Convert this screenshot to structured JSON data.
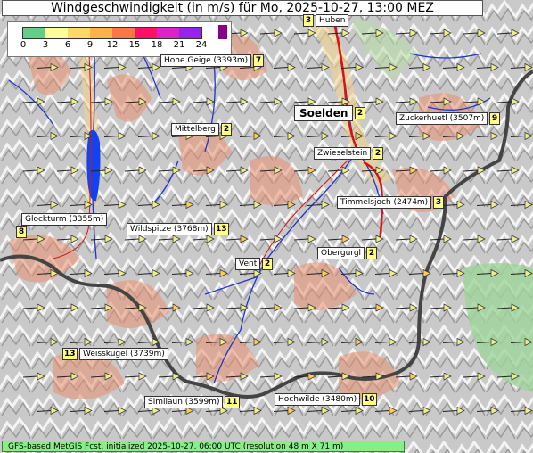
{
  "title": "Windgeschwindigkeit (in m/s) für Mo, 2025-10-27, 13:00 MEZ",
  "legend": {
    "ticks": [
      "0",
      "3",
      "6",
      "9",
      "12",
      "15",
      "18",
      "21",
      "24"
    ],
    "colors": [
      "#66cc88",
      "#ffff99",
      "#ffd966",
      "#ffb347",
      "#ff7744",
      "#ff1166",
      "#dd22cc",
      "#9922ee"
    ],
    "end_color": "#880088"
  },
  "places": [
    {
      "name": "Huben",
      "value": "3"
    },
    {
      "name": "Hohe Geige (3393m)",
      "value": "7"
    },
    {
      "name": "Soelden",
      "value": "2"
    },
    {
      "name": "Zuckerhuetl (3507m)",
      "value": "9"
    },
    {
      "name": "Mittelberg",
      "value": "2"
    },
    {
      "name": "Zwieselstein",
      "value": "2"
    },
    {
      "name": "Timmelsjoch (2474m)",
      "value": "3"
    },
    {
      "name": "Glockturm (3355m)",
      "value": "8"
    },
    {
      "name": "Wildspitze (3768m)",
      "value": "13"
    },
    {
      "name": "Obergurgl",
      "value": "2"
    },
    {
      "name": "Vent",
      "value": "2"
    },
    {
      "name": "Weisskugel (3739m)",
      "value": "13"
    },
    {
      "name": "Similaun (3599m)",
      "value": "11"
    },
    {
      "name": "Hochwilde (3480m)",
      "value": "10"
    }
  ],
  "map": {
    "wind_direction": "west",
    "colors": {
      "terrain": "#d4d4d4",
      "ridge": "#f0f0f0",
      "wind_low": "#e88a6a",
      "wind_mid": "#f0c080",
      "border": "#444444",
      "river": "#2233cc",
      "road": "#dd1111",
      "lake": "#1144ee",
      "green": "#88cc88"
    }
  },
  "footer": "GFS-based MetGIS Fcst, initialized 2025-10-27, 06:00 UTC  (resolution 48 m X 71 m)"
}
